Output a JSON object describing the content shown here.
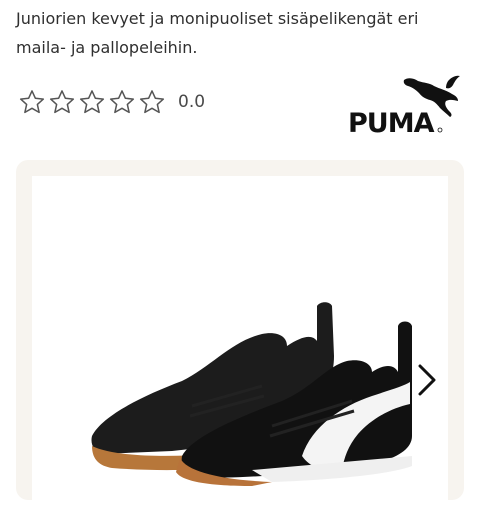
{
  "product": {
    "description": "Juniorien kevyet ja monipuoliset sisäpelikengät eri maila- ja pallopeleihin."
  },
  "rating": {
    "stars_total": 5,
    "stars_filled": 0,
    "value_text": "0.0"
  },
  "brand": {
    "name": "PUMA",
    "icon": "puma-cat-logo"
  },
  "gallery": {
    "next_icon": "chevron-right-icon",
    "image_subject": "shoe"
  },
  "colors": {
    "star_outline": "#555555",
    "gallery_bg": "#f7f4ef",
    "text": "#2f2f2f"
  }
}
